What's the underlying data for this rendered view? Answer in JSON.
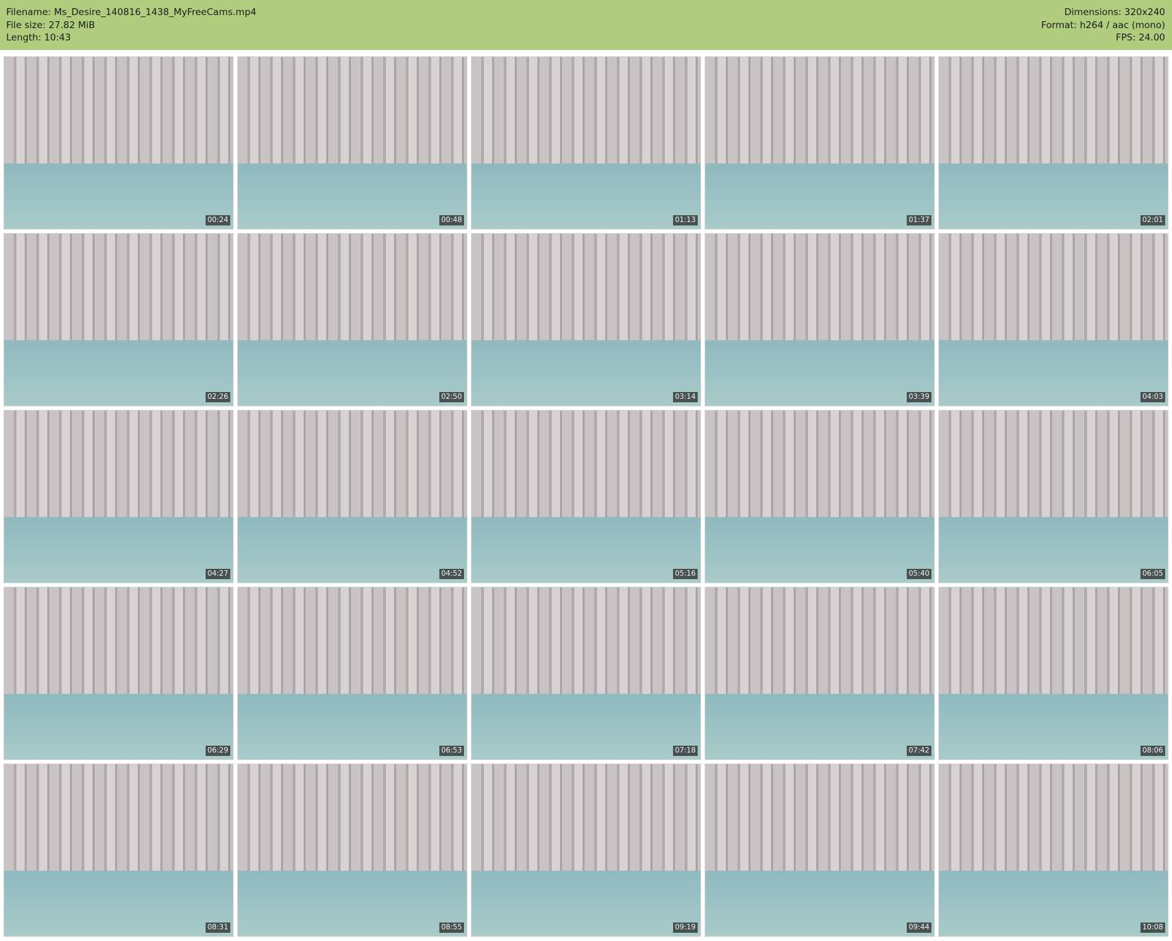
{
  "header": {
    "filename": "Filename: Ms_Desire_140816_1438_MyFreeCams.mp4",
    "filesize": "File size: 27.82 MiB",
    "length": "Length: 10:43",
    "dimensions": "Dimensions: 320x240",
    "format": "Format: h264 / aac (mono)",
    "fps": "FPS: 24.00"
  },
  "colors": {
    "header_bg": "#b0cd7e"
  },
  "frames": [
    "00:24",
    "00:48",
    "01:13",
    "01:37",
    "02:01",
    "02:26",
    "02:50",
    "03:14",
    "03:39",
    "04:03",
    "04:27",
    "04:52",
    "05:16",
    "05:40",
    "06:05",
    "06:29",
    "06:53",
    "07:18",
    "07:42",
    "08:06",
    "08:31",
    "08:55",
    "09:19",
    "09:44",
    "10:08"
  ]
}
